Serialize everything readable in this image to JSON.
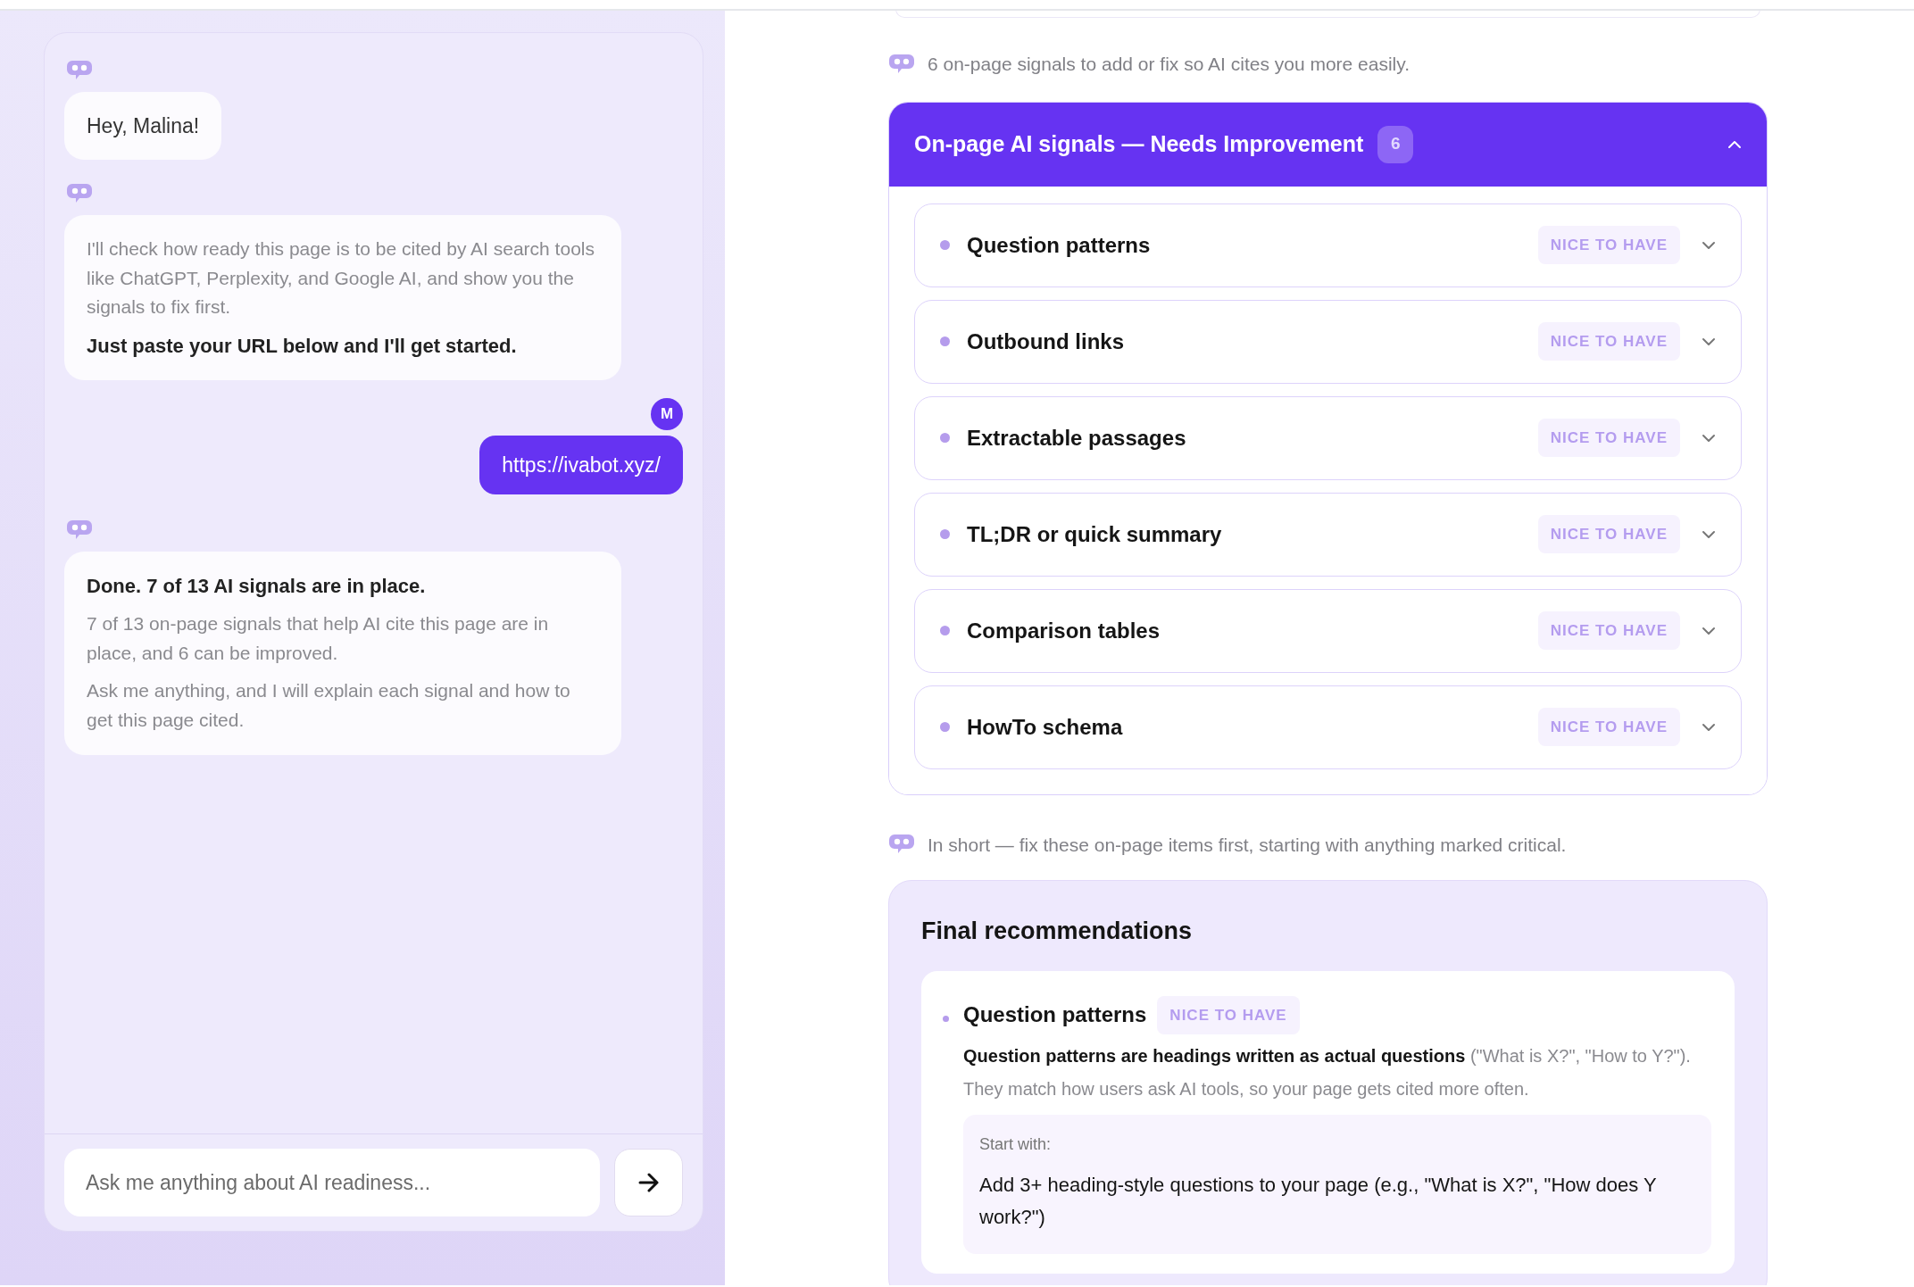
{
  "chat": {
    "messages": [
      {
        "kind": "bot",
        "paragraphs": [
          {
            "kind": "greeting",
            "text": "Hey, Malina!"
          }
        ]
      },
      {
        "kind": "bot",
        "paragraphs": [
          {
            "kind": "detail",
            "text": "I'll check how ready this page is to be cited by AI search tools like ChatGPT, Perplexity, and Google AI, and show you the signals to fix first."
          },
          {
            "kind": "headline",
            "text": "Just paste your URL below and I'll get started."
          }
        ]
      },
      {
        "kind": "user",
        "avatar": "M",
        "text": "https://ivabot.xyz/"
      },
      {
        "kind": "bot",
        "paragraphs": [
          {
            "kind": "headline",
            "text": "Done. 7 of 13 AI signals are in place."
          },
          {
            "kind": "detail",
            "text": "7 of 13 on-page signals that help AI cite this page are in place, and 6 can be improved."
          },
          {
            "kind": "detail",
            "text": "Ask me anything, and I will explain each signal and how to get this page cited."
          }
        ]
      }
    ],
    "input": {
      "placeholder": "Ask me anything about AI readiness..."
    }
  },
  "report": {
    "intro": "6 on-page signals to add or fix so AI cites you more easily.",
    "panel": {
      "title": "On-page AI signals — Needs Improvement",
      "count": "6",
      "expanded": true,
      "items": [
        {
          "label": "Question patterns",
          "priority": "NICE TO HAVE",
          "expanded": false
        },
        {
          "label": "Outbound links",
          "priority": "NICE TO HAVE",
          "expanded": false
        },
        {
          "label": "Extractable passages",
          "priority": "NICE TO HAVE",
          "expanded": false
        },
        {
          "label": "TL;DR or quick summary",
          "priority": "NICE TO HAVE",
          "expanded": false
        },
        {
          "label": "Comparison tables",
          "priority": "NICE TO HAVE",
          "expanded": false
        },
        {
          "label": "HowTo schema",
          "priority": "NICE TO HAVE",
          "expanded": false
        }
      ]
    },
    "summary": "In short — fix these on-page items first, starting with anything marked critical.",
    "recommendations": {
      "title": "Final recommendations",
      "items": [
        {
          "label": "Question patterns",
          "priority": "NICE TO HAVE",
          "description": "**Question patterns are headings written as actual questions** (\"What is X?\", \"How to Y?\"). They match how users ask AI tools, so your page gets cited more often.",
          "start_label": "Start with:",
          "start_text": "Add 3+ heading-style questions to your page (e.g., \"What is X?\", \"How does Y work?\")"
        }
      ]
    }
  }
}
